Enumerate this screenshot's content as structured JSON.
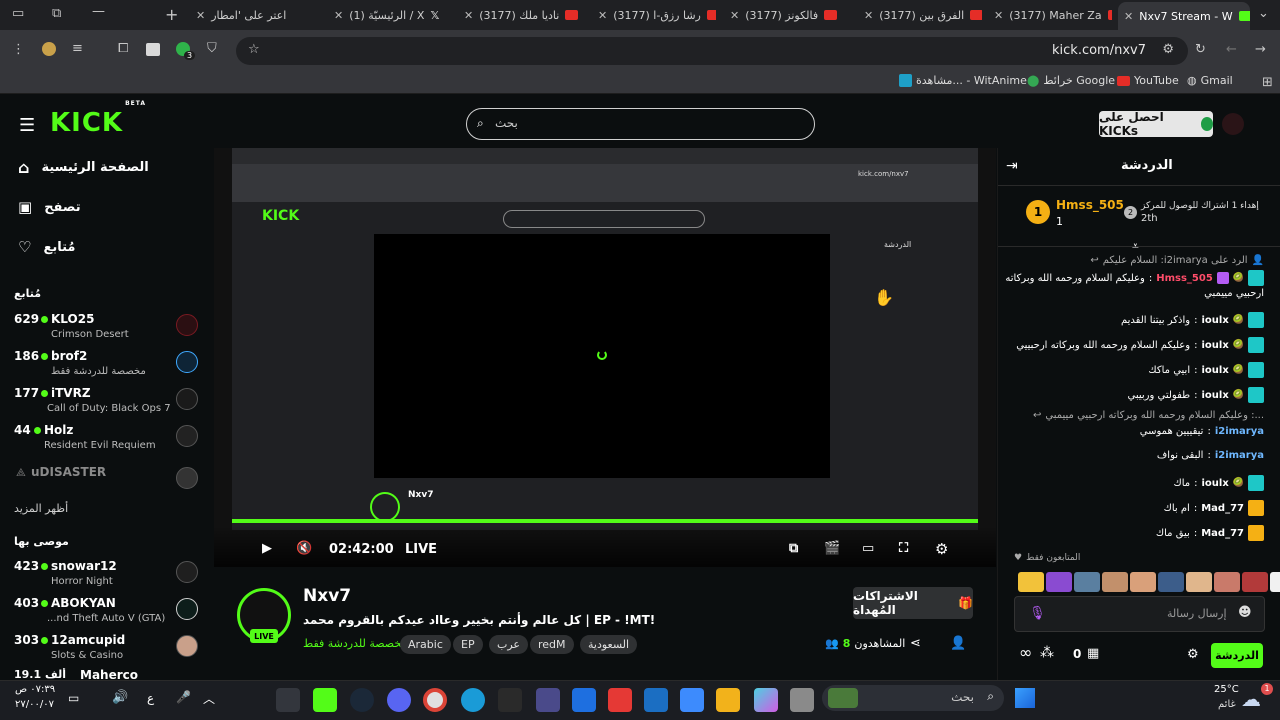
{
  "browser": {
    "tabs": [
      {
        "label": "اعتر على 'امطار"
      },
      {
        "label": "(1) الرئيسيّة / X"
      },
      {
        "label": "(3177) ناديا ملك"
      },
      {
        "label": "(3177) رشا رزق-ا"
      },
      {
        "label": "(3177) فالكونز"
      },
      {
        "label": "(3177) الفرق بين"
      },
      {
        "label": "(3177) Maher Za"
      },
      {
        "label": "Nxv7 Stream - W"
      }
    ],
    "url": "kick.com/nxv7",
    "extension_badge": "3",
    "bookmarks": [
      {
        "label": "Gmail"
      },
      {
        "label": "YouTube"
      },
      {
        "label": "خرائط Google"
      },
      {
        "label": "مشاهدة... - WitAnime"
      }
    ]
  },
  "kick": {
    "logo": "KICK",
    "logo_beta": "BETA",
    "search_placeholder": "بحث",
    "get_kicks": "احصل على KICKs",
    "nav": [
      {
        "label": "الصفحة الرئيسية",
        "icon": "home-icon"
      },
      {
        "label": "تصفح",
        "icon": "browse-icon"
      },
      {
        "label": "مُتابع",
        "icon": "heart-icon"
      }
    ],
    "following_header": "مُتابع",
    "following": [
      {
        "count": "629",
        "name": "KLO25",
        "category": "Crimson Desert"
      },
      {
        "count": "186",
        "name": "brof2",
        "category": "مخصصة للدردشة فقط"
      },
      {
        "count": "177",
        "name": "iTVRZ",
        "category": "Call of Duty: Black Ops 7"
      },
      {
        "count": "44",
        "name": "Holz",
        "category": "Resident Evil Requiem"
      }
    ],
    "offline_channel": "uDISASTER",
    "show_more": "أظهر المزيد",
    "recommended_header": "موصى بها",
    "recommended": [
      {
        "count": "423",
        "name": "snowar12",
        "category": "Horror Night"
      },
      {
        "count": "403",
        "name": "ABOKYAN",
        "category": "...nd Theft Auto V (GTA)"
      },
      {
        "count": "303",
        "name": "12amcupid",
        "category": "Slots & Casino"
      },
      {
        "count": "19.1 ألف",
        "name": "Maherco",
        "category": ""
      }
    ]
  },
  "player": {
    "time": "02:42:00",
    "live_label": "LIVE",
    "inner_url": "kick.com/nxv7",
    "inner_chat_title": "الدردشة",
    "inner_streamer": "Nxv7"
  },
  "stream": {
    "streamer": "Nxv7",
    "live_badge": "LIVE",
    "title": "كل عالم وأنتم بخيير وعااد عيدكم بالقروم محمد | EP - !MT!",
    "category": "مخصصة للدردشة فقط",
    "tags": [
      "Arabic",
      "EP",
      "عرب",
      "redM",
      "السعودية"
    ],
    "viewers_label": "المشاهدون",
    "viewers": "8",
    "subscribe_button": "الاشتراكات المُهداة"
  },
  "chat": {
    "title": "الدردشة",
    "pinned_user": "Hmss_505",
    "pinned_count": "1",
    "pinned_rank": "2",
    "pinned_rank_text": "2th",
    "pinned_gift_text": "إهداء 1 اشتراك للوصول للمركز",
    "messages": [
      {
        "reply": "الرد على i2imarya: السلام عليكم",
        "user": "Hmss_505",
        "text": "وعليكم السلام ورحمه الله وبركاته",
        "text2": "ارحبيي مييمبي",
        "color": "#ff4d6a"
      },
      {
        "user": "ioulx",
        "text": "واذكر بيتنا القديم",
        "color": "#ffffff"
      },
      {
        "user": "ioulx",
        "text": "وعليكم السلام ورحمه الله وبركاته ارحبييي",
        "color": "#ffffff"
      },
      {
        "user": "ioulx",
        "text": "ابيي ماكك",
        "color": "#ffffff"
      },
      {
        "user": "ioulx",
        "text": "طفولتي وربيبي",
        "color": "#ffffff"
      },
      {
        "reply": "...: وعليكم السلام ورحمه الله وبركاته ارحبيي مييمبي",
        "user": "i2imarya",
        "text": "تيقييين هموسي",
        "color": "#6fb8ff"
      },
      {
        "user": "i2imarya",
        "text": "البقى نواف",
        "color": "#6fb8ff"
      },
      {
        "user": "ioulx",
        "text": "ماك",
        "color": "#ffffff"
      },
      {
        "user": "Mad_77",
        "text": "ام باك",
        "color": "#ffffff"
      },
      {
        "user": "Mad_77",
        "text": "بيق ماك",
        "color": "#ffffff"
      }
    ],
    "followers_only": "المتابعون فقط",
    "input_placeholder": "إرسال رسالة",
    "kicks_count": "0",
    "send_button": "الدردشة"
  },
  "taskbar": {
    "weather_temp": "25°C",
    "weather_text": "غائم",
    "search_placeholder": "بحث",
    "time": "٠٧:٣٩ ص",
    "date": "٢٧/٠٠/٠٧",
    "lang": "ع",
    "notification_badge": "1"
  }
}
